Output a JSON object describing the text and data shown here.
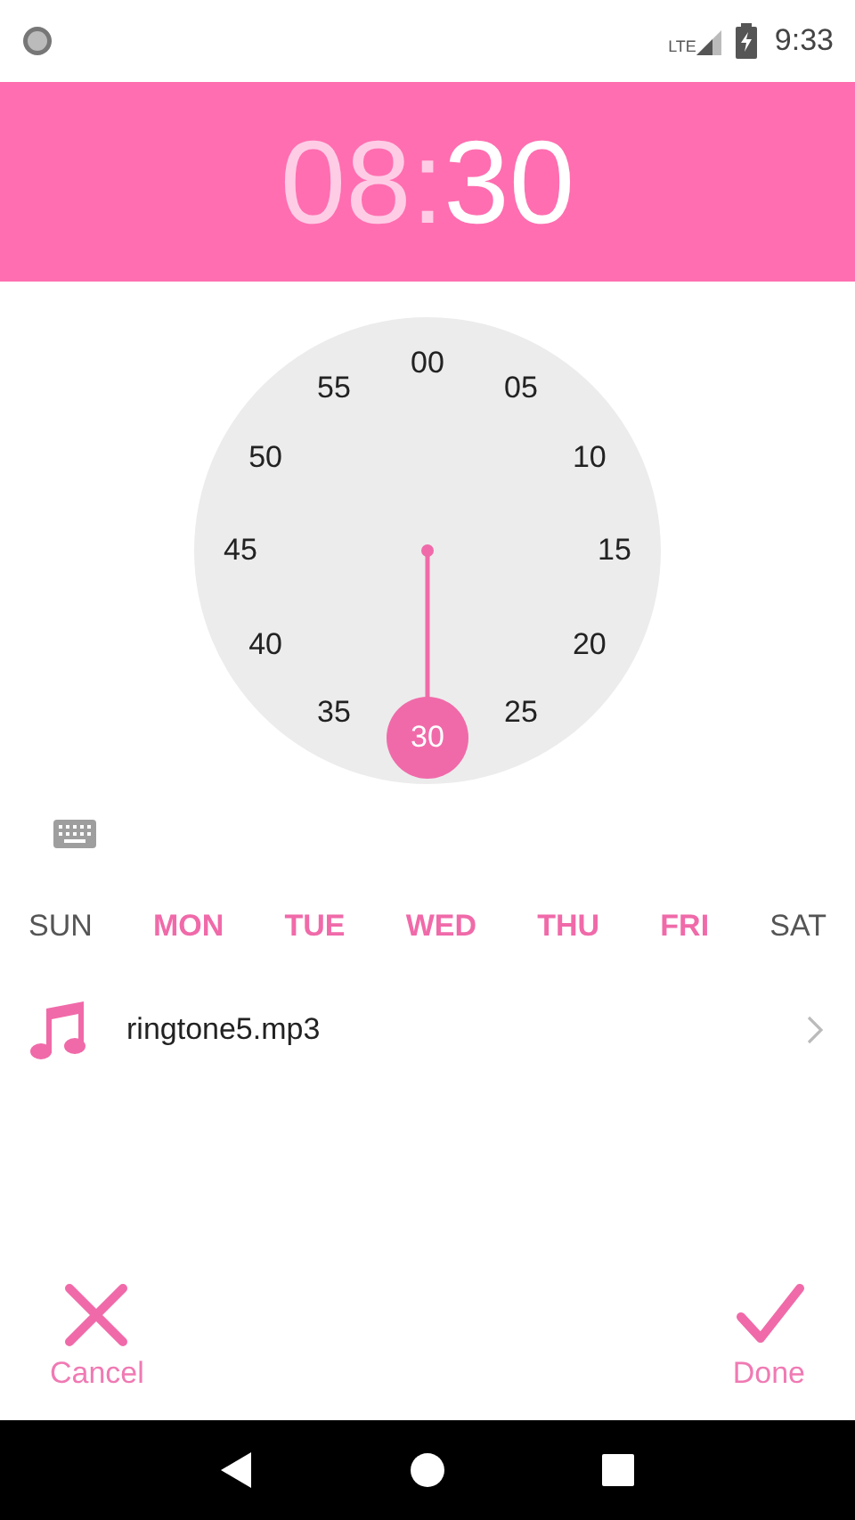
{
  "status_bar": {
    "network": "LTE",
    "time": "9:33"
  },
  "time_header": {
    "hours": {
      "text": "08",
      "selected": false
    },
    "separator": ":",
    "minutes": {
      "text": "30",
      "selected": true
    }
  },
  "dial": {
    "minutes": [
      {
        "label": "00",
        "selected": false
      },
      {
        "label": "05",
        "selected": false
      },
      {
        "label": "10",
        "selected": false
      },
      {
        "label": "15",
        "selected": false
      },
      {
        "label": "20",
        "selected": false
      },
      {
        "label": "25",
        "selected": false
      },
      {
        "label": "30",
        "selected": true
      },
      {
        "label": "35",
        "selected": false
      },
      {
        "label": "40",
        "selected": false
      },
      {
        "label": "45",
        "selected": false
      },
      {
        "label": "50",
        "selected": false
      },
      {
        "label": "55",
        "selected": false
      }
    ]
  },
  "days": [
    {
      "label": "SUN",
      "selected": false
    },
    {
      "label": "MON",
      "selected": true
    },
    {
      "label": "TUE",
      "selected": true
    },
    {
      "label": "WED",
      "selected": true
    },
    {
      "label": "THU",
      "selected": true
    },
    {
      "label": "FRI",
      "selected": true
    },
    {
      "label": "SAT",
      "selected": false
    }
  ],
  "ringtone": {
    "name": "ringtone5.mp3"
  },
  "actions": [
    {
      "kind": "cancel",
      "label": "Cancel"
    },
    {
      "kind": "done",
      "label": "Done"
    }
  ]
}
